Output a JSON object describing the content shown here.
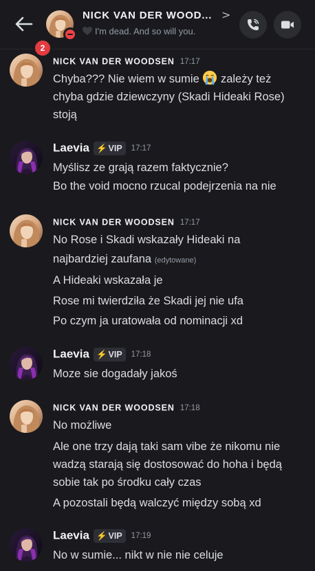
{
  "header": {
    "unread_count": "2",
    "title": "NICK VAN DER WOOD...",
    "chevron": ">",
    "status": "I'm dead. And so will you."
  },
  "colors": {
    "background": "#1a1a1e",
    "badge": "#e23b41",
    "dnd": "#ed4245",
    "vip_bolt": "#f5c542"
  },
  "messages": [
    {
      "author": "NICK VAN DER WOODSEN",
      "time": "17:17",
      "lines": [
        "Chyba??? Nie wiem w sumie",
        "zależy też",
        "chyba gdzie dziewczyny (Skadi Hideaki Rose)",
        "stoją"
      ]
    },
    {
      "author": "Laevia",
      "badge": "VIP",
      "time": "17:17",
      "lines": [
        "Myślisz ze grają razem faktycznie?",
        "Bo the void mocno rzucal podejrzenia na nie"
      ]
    },
    {
      "author": "NICK VAN DER WOODSEN",
      "time": "17:17",
      "lines": [
        "No Rose i Skadi wskazały Hideaki na",
        "najbardziej zaufana",
        "(edytowane)",
        "A Hideaki wskazała je",
        "Rose mi twierdziła że Skadi jej nie ufa",
        "Po czym ja uratowała od nominacji xd"
      ]
    },
    {
      "author": "Laevia",
      "badge": "VIP",
      "time": "17:18",
      "lines": [
        "Moze sie dogadały jakoś"
      ]
    },
    {
      "author": "NICK VAN DER WOODSEN",
      "time": "17:18",
      "lines": [
        "No możliwe",
        "Ale one trzy dają taki sam vibe że nikomu nie",
        "wadzą starają się dostosować do hoha i będą",
        "sobie tak po środku cały czas",
        "A pozostali będą walczyć między sobą xd"
      ]
    },
    {
      "author": "Laevia",
      "badge": "VIP",
      "time": "17:19",
      "lines": [
        "No w sumie... nikt w nie nie celuje"
      ]
    }
  ]
}
